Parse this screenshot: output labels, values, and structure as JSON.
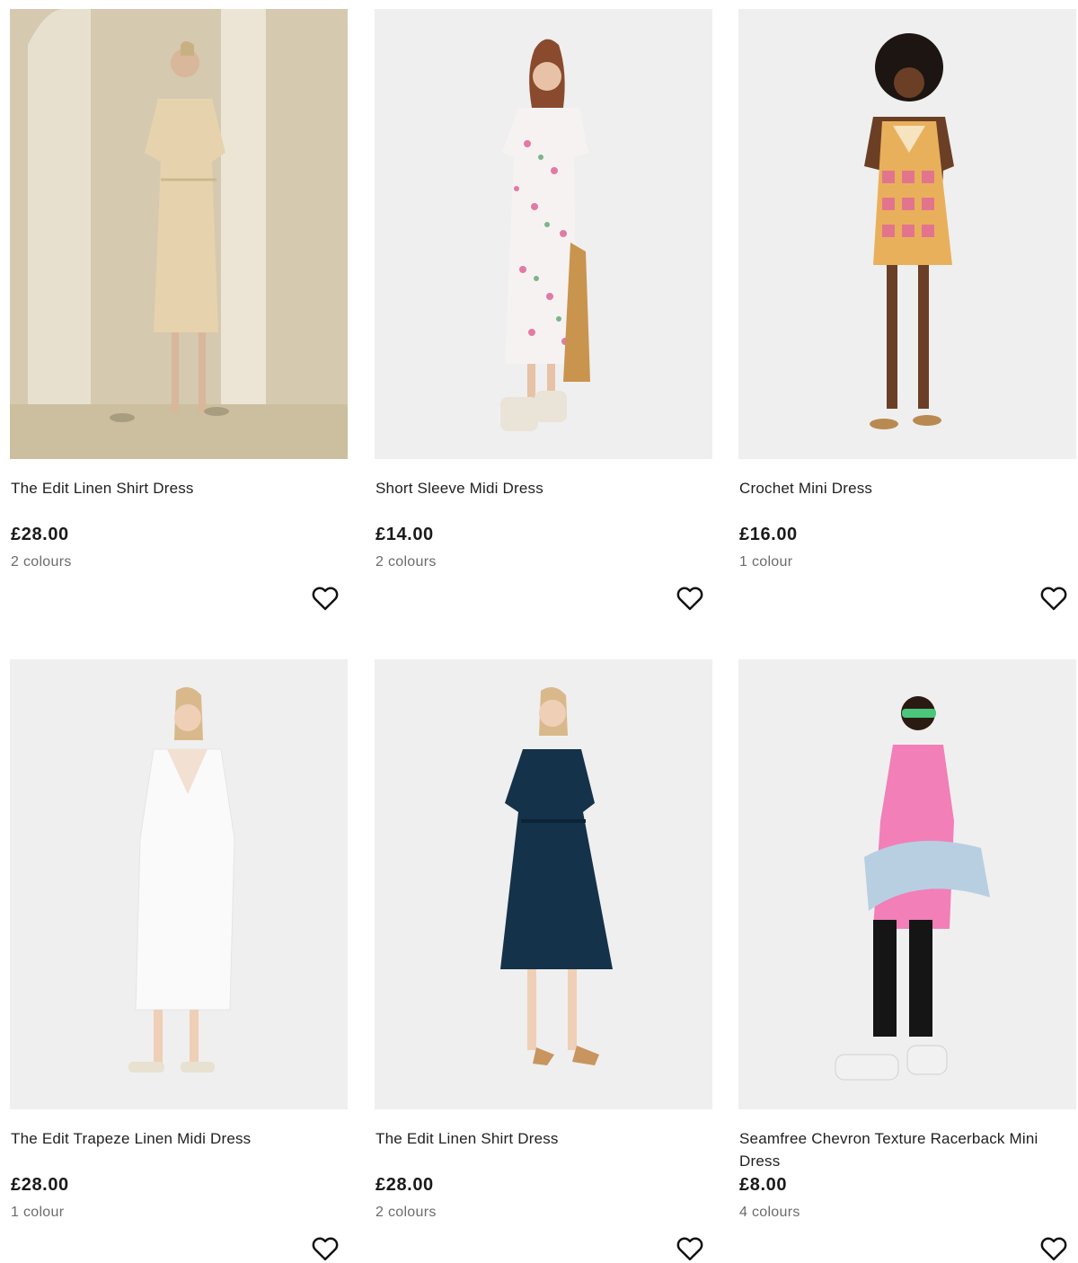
{
  "products": [
    {
      "title": "The Edit Linen Shirt Dress",
      "price": "£28.00",
      "colours": "2 colours",
      "image_alt": "Model wearing beige linen shirt dress"
    },
    {
      "title": "Short Sleeve Midi Dress",
      "price": "£14.00",
      "colours": "2 colours",
      "image_alt": "Model wearing white floral midi dress"
    },
    {
      "title": "Crochet Mini Dress",
      "price": "£16.00",
      "colours": "1 colour",
      "image_alt": "Model wearing crochet mini dress"
    },
    {
      "title": "The Edit Trapeze Linen Midi Dress",
      "price": "£28.00",
      "colours": "1 colour",
      "image_alt": "Model wearing white trapeze linen dress"
    },
    {
      "title": "The Edit Linen Shirt Dress",
      "price": "£28.00",
      "colours": "2 colours",
      "image_alt": "Model wearing navy linen shirt dress"
    },
    {
      "title": "Seamfree Chevron Texture Racerback Mini Dress",
      "price": "£8.00",
      "colours": "4 colours",
      "image_alt": "Model wearing pink racerback mini dress"
    }
  ],
  "icons": {
    "wishlist": "heart-outline-icon"
  },
  "colors": {
    "price_text": "#1a1a1a",
    "muted_text": "#6b6b6b",
    "photo_bg_studio": "#efefef",
    "photo_bg_beige": "#d9cdb6"
  }
}
